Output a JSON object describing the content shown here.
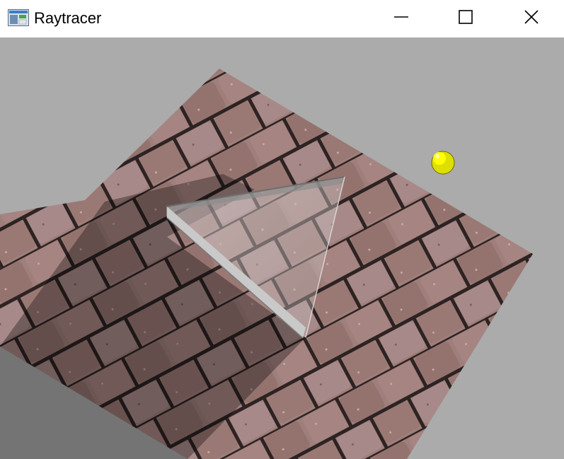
{
  "window": {
    "title": "Raytracer"
  },
  "titlebar": {
    "icons": {
      "app": "app-window-icon",
      "minimize": "minimize-icon",
      "maximize": "maximize-icon",
      "close": "close-icon"
    }
  },
  "scene": {
    "background_color": "#ababab",
    "floor_texture": "stone-brick",
    "floor_color": "#9a7a76",
    "light_color": "#ffff00",
    "objects": [
      "textured-floor-plane",
      "glass-prism",
      "yellow-light-sphere",
      "shadow"
    ]
  }
}
